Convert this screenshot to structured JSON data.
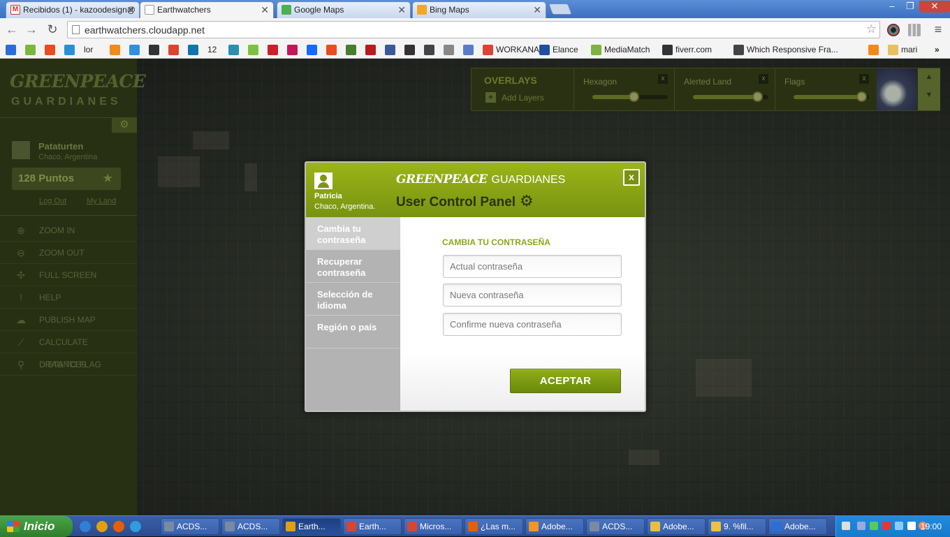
{
  "browser": {
    "tabs": [
      {
        "label": "Recibidos (1) - kazoodesign@",
        "icon": "gmail-icon",
        "color": "#d93025"
      },
      {
        "label": "Earthwatchers",
        "icon": "page-icon",
        "color": "#ffffff"
      },
      {
        "label": "Google Maps",
        "icon": "google-maps-icon",
        "color": "#4caf50"
      },
      {
        "label": "Bing Maps",
        "icon": "bing-icon",
        "color": "#f5a623"
      }
    ],
    "active_tab": 1,
    "close_glyph": "✕",
    "url": "earthwatchers.cloudapp.net",
    "window_buttons": {
      "minimize": "–",
      "maximize": "❐",
      "close": "✕"
    },
    "bookmarks": [
      {
        "label": "",
        "color": "#2a6fd6"
      },
      {
        "label": "",
        "color": "#7ab83b"
      },
      {
        "label": "",
        "color": "#e94c1f"
      },
      {
        "label": "",
        "color": "#2a8fd6"
      },
      {
        "label": "lor",
        "color": ""
      },
      {
        "label": "",
        "color": "#f08a1c"
      },
      {
        "label": "",
        "color": "#2f8fe0"
      },
      {
        "label": "",
        "color": "#333333"
      },
      {
        "label": "",
        "color": "#d9452f"
      },
      {
        "label": "",
        "color": "#0e76a8"
      },
      {
        "label": "12",
        "color": ""
      },
      {
        "label": "",
        "color": "#2a8fb0"
      },
      {
        "label": "",
        "color": "#7cc242"
      },
      {
        "label": "",
        "color": "#cb2027"
      },
      {
        "label": "",
        "color": "#c2185b"
      },
      {
        "label": "",
        "color": "#1769ff"
      },
      {
        "label": "",
        "color": "#e94c1f"
      },
      {
        "label": "",
        "color": "#4a7d2b"
      },
      {
        "label": "",
        "color": "#b71c1c"
      },
      {
        "label": "",
        "color": "#3b5998"
      },
      {
        "label": "",
        "color": "#333333"
      },
      {
        "label": "",
        "color": "#444444"
      },
      {
        "label": "",
        "color": "#888888"
      },
      {
        "label": "",
        "color": "#5a7cc8"
      },
      {
        "label": "WORKANA",
        "color": "#db4437"
      },
      {
        "label": "Elance",
        "color": "#1e4fa0"
      },
      {
        "label": "MediaMatch",
        "color": "#7cb342"
      },
      {
        "label": "fiverr.com",
        "color": "#333333"
      },
      {
        "label": "Which Responsive Fra...",
        "color": "#444444"
      },
      {
        "label": "",
        "color": "#f08a1c"
      },
      {
        "label": "mari",
        "color": "#e8c060"
      }
    ],
    "more_glyph": "»"
  },
  "sidebar": {
    "logo_top": "GREENPEACE",
    "logo_bottom": "GUARDIANES",
    "settings_glyph": "⚙",
    "user": {
      "name": "Pataturten",
      "location": "Chaco, Argentina"
    },
    "points": "128 Puntos",
    "points_glyph": "★",
    "links": {
      "logout": "Log Out",
      "myland": "My Land"
    },
    "menu": [
      {
        "label": "ZOOM IN",
        "icon": "zoom-in-icon",
        "glyph": "⊕"
      },
      {
        "label": "ZOOM OUT",
        "icon": "zoom-out-icon",
        "glyph": "⊖"
      },
      {
        "label": "FULL SCREEN",
        "icon": "fullscreen-icon",
        "glyph": "✣"
      },
      {
        "label": "HELP",
        "icon": "help-icon",
        "glyph": "!"
      },
      {
        "label": "PUBLISH MAP",
        "icon": "cloud-icon",
        "glyph": "☁"
      },
      {
        "label": "CALCULATE DISTANCES",
        "icon": "ruler-icon",
        "glyph": "⟋"
      },
      {
        "label": "DRAG TO FLAG",
        "icon": "flag-pin-icon",
        "glyph": "⚲"
      }
    ]
  },
  "overlays": {
    "title": "OVERLAYS",
    "add_label": "Add Layers",
    "add_glyph": "+",
    "close_glyph": "x",
    "layers": [
      {
        "label": "Hexagon",
        "level": 0.55
      },
      {
        "label": "Alerted Land",
        "level": 0.85
      },
      {
        "label": "Flags",
        "level": 0.9
      }
    ],
    "up_glyph": "▲",
    "down_glyph": "▼"
  },
  "modal": {
    "user": {
      "name": "Patricia",
      "location": "Chaco, Argentina."
    },
    "brand_top": "GREENPEACE",
    "brand_bottom": "GUARDIANES",
    "title": "User Control Panel",
    "gear_glyph": "⚙",
    "close_glyph": "x",
    "nav": [
      {
        "label": "Cambia tu contraseña",
        "active": true
      },
      {
        "label": "Recuperar contraseña",
        "active": false
      },
      {
        "label": "Selección de idioma",
        "active": false
      },
      {
        "label": "Región o país",
        "active": false
      }
    ],
    "section_title": "CAMBIA TU CONTRASEÑA",
    "fields": {
      "current": "Actual contraseña",
      "new": "Nueva contraseña",
      "confirm": "Confirme nueva contraseña"
    },
    "submit_label": "ACEPTAR",
    "accent_color": "#8aa81a"
  },
  "taskbar": {
    "start_label": "Inicio",
    "quicklaunch": [
      {
        "icon": "ie-icon",
        "color": "#2f7fd6"
      },
      {
        "icon": "chrome-icon",
        "color": "#e0a10e"
      },
      {
        "icon": "firefox-icon",
        "color": "#e66000"
      },
      {
        "icon": "ie-edge-icon",
        "color": "#2f9be0"
      }
    ],
    "items": [
      {
        "label": "ACDS...",
        "color": "#7a8aa0"
      },
      {
        "label": "ACDS...",
        "color": "#7a8aa0"
      },
      {
        "label": "Earth...",
        "color": "#e0a10e"
      },
      {
        "label": "Earth...",
        "color": "#d9452f"
      },
      {
        "label": "Micros...",
        "color": "#d9452f"
      },
      {
        "label": "¿Las m...",
        "color": "#e66000"
      },
      {
        "label": "Adobe...",
        "color": "#f7941d"
      },
      {
        "label": "ACDS...",
        "color": "#7a8aa0"
      },
      {
        "label": "Adobe...",
        "color": "#e8c040"
      },
      {
        "label": "9. %fil...",
        "color": "#f0c040"
      },
      {
        "label": "Adobe...",
        "color": "#2a6fd6"
      }
    ],
    "clock": "19:00"
  }
}
